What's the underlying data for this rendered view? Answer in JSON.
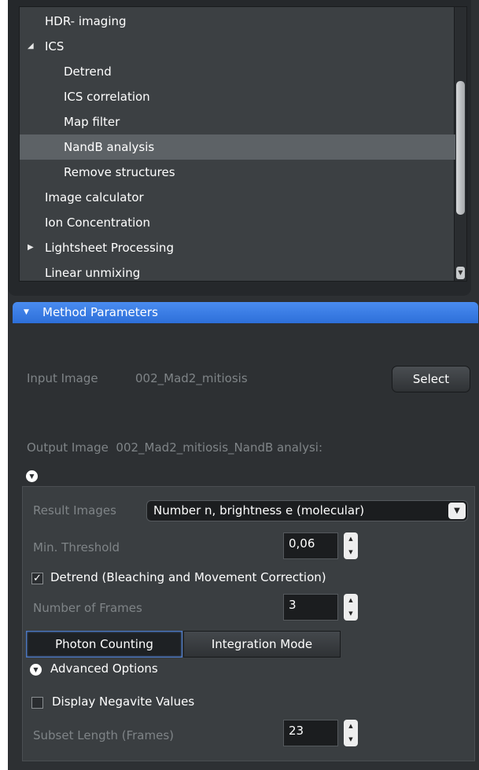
{
  "tree": {
    "items": [
      {
        "label": "HDR- imaging",
        "indent": 0,
        "expander": "",
        "selected": false
      },
      {
        "label": "ICS",
        "indent": 0,
        "expander": "expanded",
        "selected": false
      },
      {
        "label": "Detrend",
        "indent": 1,
        "expander": "",
        "selected": false
      },
      {
        "label": "ICS correlation",
        "indent": 1,
        "expander": "",
        "selected": false
      },
      {
        "label": "Map filter",
        "indent": 1,
        "expander": "",
        "selected": false
      },
      {
        "label": "NandB analysis",
        "indent": 1,
        "expander": "",
        "selected": true
      },
      {
        "label": "Remove structures",
        "indent": 1,
        "expander": "",
        "selected": false
      },
      {
        "label": "Image calculator",
        "indent": 0,
        "expander": "",
        "selected": false
      },
      {
        "label": "Ion Concentration",
        "indent": 0,
        "expander": "",
        "selected": false
      },
      {
        "label": "Lightsheet Processing",
        "indent": 0,
        "expander": "collapsed",
        "selected": false
      },
      {
        "label": "Linear unmixing",
        "indent": 0,
        "expander": "",
        "selected": false
      }
    ]
  },
  "method_parameters": {
    "title": "Method Parameters",
    "input_image_label": "Input Image",
    "input_image_value": "002_Mad2_mitiosis",
    "select_button": "Select",
    "output_image_label": "Output Image",
    "output_image_value": "002_Mad2_mitiosis_NandB analysi:",
    "result_images_label": "Result Images",
    "result_images_value": "Number n, brightness e (molecular)",
    "min_threshold_label": "Min. Threshold",
    "min_threshold_value": "0,06",
    "detrend_label": "Detrend (Bleaching and Movement Correction)",
    "detrend_checked": true,
    "number_of_frames_label": "Number of Frames",
    "number_of_frames_value": "3",
    "mode_photon_counting": "Photon Counting",
    "mode_integration": "Integration Mode",
    "active_mode": "Photon Counting",
    "advanced_options_label": "Advanced Options",
    "display_negative_label": "Display Negavite Values",
    "display_negative_checked": false,
    "subset_length_label": "Subset Length (Frames)",
    "subset_length_value": "23"
  },
  "colors": {
    "panel_bg": "#2d3033",
    "header_accent": "#3a7de6",
    "selected_row": "#5d6266",
    "dim_text": "#7f8487"
  }
}
